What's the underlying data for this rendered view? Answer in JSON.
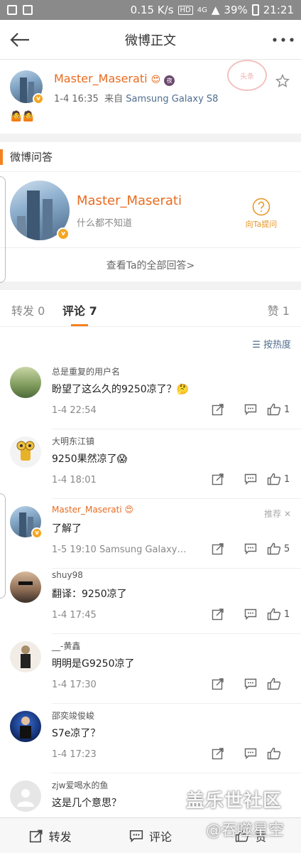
{
  "status": {
    "speed": "0.15 K/s",
    "hd": "HD",
    "signal": "4G",
    "battery": "39%",
    "time": "21:21"
  },
  "nav": {
    "title": "微博正文"
  },
  "post": {
    "author": "Master_Maserati",
    "time": "1-4 16:35",
    "from_label": "来自",
    "source": "Samsung Galaxy S8",
    "content": "🤷🤷",
    "stamp": "头条"
  },
  "qa": {
    "section_title": "微博问答",
    "name": "Master_Maserati",
    "bio": "什么都不知道",
    "ask_label": "向Ta提问",
    "view_all": "查看Ta的全部回答>"
  },
  "tabs": {
    "repost": "转发 0",
    "comments": "评论 7",
    "likes": "赞 1"
  },
  "sort_label": "按热度",
  "comments": [
    {
      "name": "总是重复的用户名",
      "text": "盼望了这么久的9250凉了？🤔",
      "time": "1-4 22:54",
      "likes": "1"
    },
    {
      "name": "大明东江镇",
      "text": "9250果然凉了😱",
      "time": "1-4 18:01",
      "likes": "1"
    },
    {
      "name": "Master_Maserati",
      "text": "了解了",
      "time": "1-5 19:10  Samsung Galaxy…",
      "likes": "5",
      "recommend": "推荐 ✕"
    },
    {
      "name": "shuy98",
      "text": "翻译：9250凉了",
      "time": "1-4 17:45",
      "likes": "1"
    },
    {
      "name": "__-黄鑫",
      "text": "明明是G9250凉了",
      "time": "1-4 17:30",
      "likes": ""
    },
    {
      "name": "邵奕竣俊峻",
      "text": "S7e凉了？",
      "time": "1-4 17:23",
      "likes": ""
    },
    {
      "name": "zjw爱喝水的鱼",
      "text": "这是几个意思？",
      "time": "",
      "likes": ""
    }
  ],
  "bottom": {
    "repost": "转发",
    "comment": "评论",
    "like": "赞"
  },
  "watermark": {
    "line1": "盖乐世社区",
    "line2": "@吞噬星空"
  },
  "colors": {
    "accent": "#f58220",
    "name_orange": "#e86b1f",
    "link_blue": "#4f6d8f"
  }
}
